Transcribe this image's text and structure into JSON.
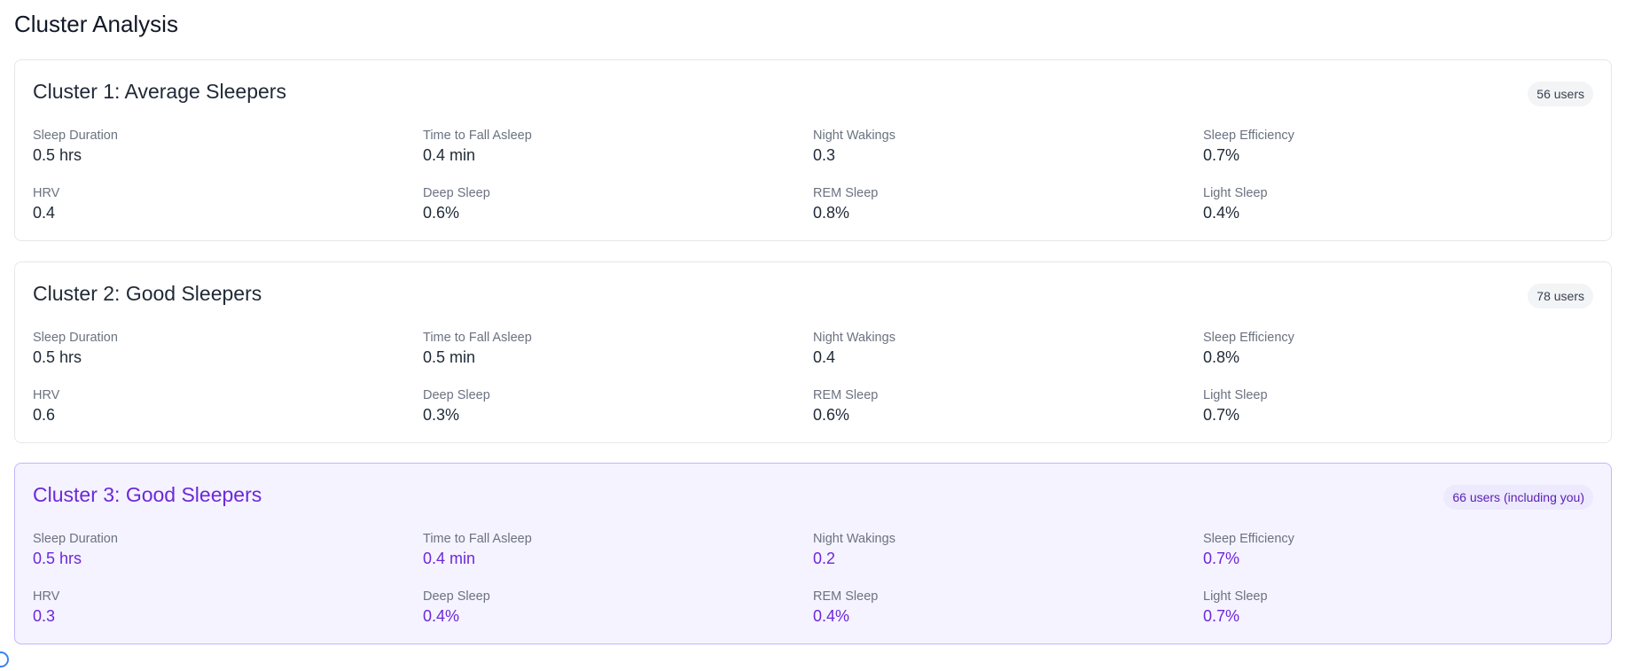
{
  "page": {
    "title": "Cluster Analysis"
  },
  "clusters": [
    {
      "title": "Cluster 1: Average Sleepers",
      "badge": "56 users",
      "metrics": [
        {
          "label": "Sleep Duration",
          "value": "0.5 hrs"
        },
        {
          "label": "Time to Fall Asleep",
          "value": "0.4 min"
        },
        {
          "label": "Night Wakings",
          "value": "0.3"
        },
        {
          "label": "Sleep Efficiency",
          "value": "0.7%"
        },
        {
          "label": "HRV",
          "value": "0.4"
        },
        {
          "label": "Deep Sleep",
          "value": "0.6%"
        },
        {
          "label": "REM Sleep",
          "value": "0.8%"
        },
        {
          "label": "Light Sleep",
          "value": "0.4%"
        }
      ]
    },
    {
      "title": "Cluster 2: Good Sleepers",
      "badge": "78 users",
      "metrics": [
        {
          "label": "Sleep Duration",
          "value": "0.5 hrs"
        },
        {
          "label": "Time to Fall Asleep",
          "value": "0.5 min"
        },
        {
          "label": "Night Wakings",
          "value": "0.4"
        },
        {
          "label": "Sleep Efficiency",
          "value": "0.8%"
        },
        {
          "label": "HRV",
          "value": "0.6"
        },
        {
          "label": "Deep Sleep",
          "value": "0.3%"
        },
        {
          "label": "REM Sleep",
          "value": "0.6%"
        },
        {
          "label": "Light Sleep",
          "value": "0.7%"
        }
      ]
    },
    {
      "title": "Cluster 3: Good Sleepers",
      "badge": "66 users (including you)",
      "metrics": [
        {
          "label": "Sleep Duration",
          "value": "0.5 hrs"
        },
        {
          "label": "Time to Fall Asleep",
          "value": "0.4 min"
        },
        {
          "label": "Night Wakings",
          "value": "0.2"
        },
        {
          "label": "Sleep Efficiency",
          "value": "0.7%"
        },
        {
          "label": "HRV",
          "value": "0.3"
        },
        {
          "label": "Deep Sleep",
          "value": "0.4%"
        },
        {
          "label": "REM Sleep",
          "value": "0.4%"
        },
        {
          "label": "Light Sleep",
          "value": "0.7%"
        }
      ]
    }
  ],
  "colors": {
    "highlight_accent": "#6d28d9",
    "highlight_background": "#f5f3ff",
    "highlight_border": "#c4b5fd",
    "badge_background": "#f3f4f6"
  }
}
